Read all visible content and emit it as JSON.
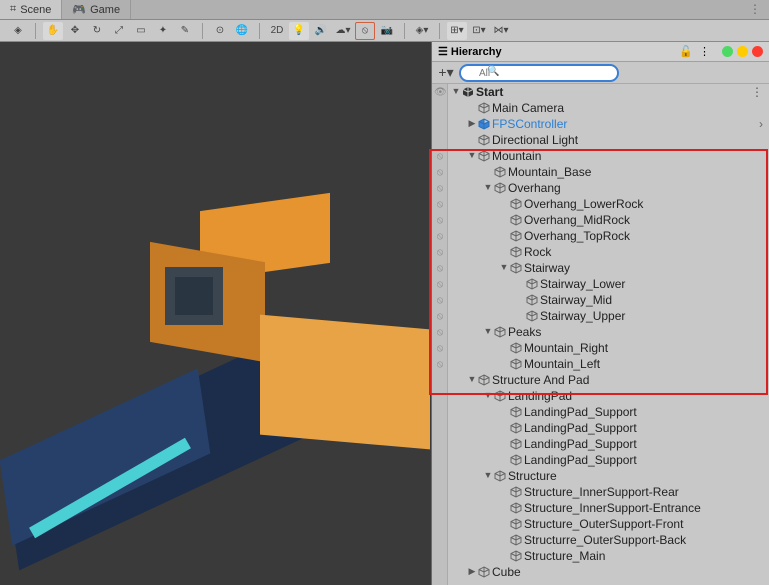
{
  "tabs": {
    "scene": "Scene",
    "game": "Game"
  },
  "toolbar": {
    "mode2d": "2D",
    "icons": {
      "view": "view-tool",
      "hand": "hand-tool",
      "move": "move-tool",
      "rotate": "rotate-tool",
      "scale": "scale-tool",
      "rect": "rect-tool",
      "transform": "transform-tool",
      "custom": "custom-tool",
      "pivot": "pivot-toggle",
      "global": "global-toggle",
      "light": "lighting-toggle",
      "audio": "audio-toggle",
      "fx": "fx-toggle",
      "hidden": "hidden-toggle",
      "camera": "camera-toggle",
      "gizmos": "gizmos-toggle",
      "grid": "grid-dropdown",
      "snap": "snap-dropdown",
      "snap2": "snap-increment"
    }
  },
  "hierarchy": {
    "title": "Hierarchy",
    "search_placeholder": "All",
    "root": "Start",
    "nodes": {
      "main_camera": "Main Camera",
      "fps": "FPSController",
      "dir_light": "Directional Light",
      "mountain": "Mountain",
      "mountain_base": "Mountain_Base",
      "overhang": "Overhang",
      "overhang_lower": "Overhang_LowerRock",
      "overhang_mid": "Overhang_MidRock",
      "overhang_top": "Overhang_TopRock",
      "rock": "Rock",
      "stairway": "Stairway",
      "stairway_lower": "Stairway_Lower",
      "stairway_mid": "Stairway_Mid",
      "stairway_upper": "Stairway_Upper",
      "peaks": "Peaks",
      "mtn_right": "Mountain_Right",
      "mtn_left": "Mountain_Left",
      "structure_pad": "Structure And Pad",
      "landingpad": "LandingPad",
      "lp_sup1": "LandingPad_Support",
      "lp_sup2": "LandingPad_Support",
      "lp_sup3": "LandingPad_Support",
      "lp_sup4": "LandingPad_Support",
      "structure": "Structure",
      "str_inner_rear": "Structure_InnerSupport-Rear",
      "str_inner_ent": "Structure_InnerSupport-Entrance",
      "str_outer_front": "Structure_OuterSupport-Front",
      "str_outer_back": "Structurre_OuterSupport-Back",
      "str_main": "Structure_Main",
      "cube": "Cube"
    }
  }
}
